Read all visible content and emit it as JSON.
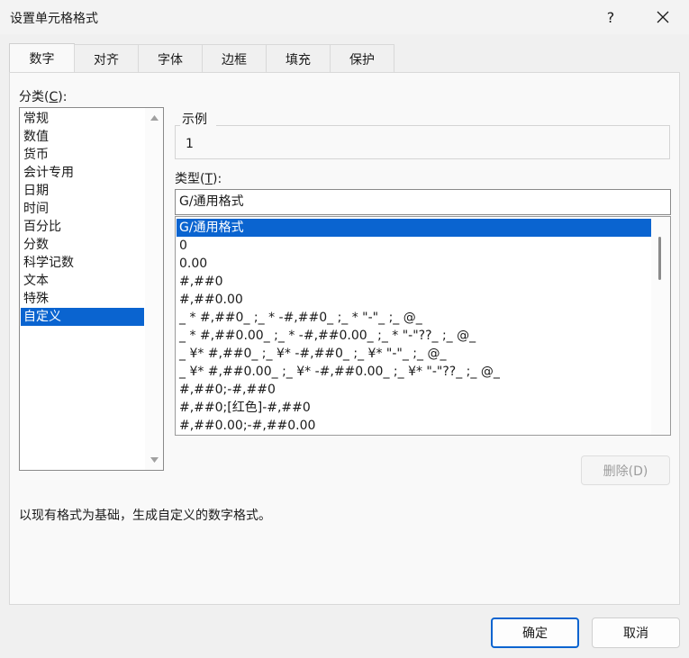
{
  "window": {
    "title": "设置单元格格式",
    "help_label": "?",
    "close_label": "✕"
  },
  "tabs": [
    {
      "label": "数字",
      "active": true
    },
    {
      "label": "对齐"
    },
    {
      "label": "字体"
    },
    {
      "label": "边框"
    },
    {
      "label": "填充"
    },
    {
      "label": "保护"
    }
  ],
  "category": {
    "label_prefix": "分类(",
    "label_key": "C",
    "label_suffix": "):",
    "items": [
      "常规",
      "数值",
      "货币",
      "会计专用",
      "日期",
      "时间",
      "百分比",
      "分数",
      "科学记数",
      "文本",
      "特殊",
      "自定义"
    ],
    "selected": "自定义"
  },
  "sample": {
    "legend": "示例",
    "value": "1"
  },
  "type": {
    "label_prefix": "类型(",
    "label_key": "T",
    "label_suffix": "):",
    "input_value": "G/通用格式",
    "items": [
      "G/通用格式",
      "0",
      "0.00",
      "#,##0",
      "#,##0.00",
      "_ * #,##0_ ;_ * -#,##0_ ;_ * \"-\"_ ;_ @_",
      "_ * #,##0.00_ ;_ * -#,##0.00_ ;_ * \"-\"??_ ;_ @_",
      "_ ¥* #,##0_ ;_ ¥* -#,##0_ ;_ ¥* \"-\"_ ;_ @_",
      "_ ¥* #,##0.00_ ;_ ¥* -#,##0.00_ ;_ ¥* \"-\"??_ ;_ @_",
      "#,##0;-#,##0",
      "#,##0;[红色]-#,##0",
      "#,##0.00;-#,##0.00"
    ],
    "selected": "G/通用格式"
  },
  "delete_button": "删除(D)",
  "description": "以现有格式为基础，生成自定义的数字格式。",
  "ok_button": "确定",
  "cancel_button": "取消",
  "colors": {
    "selection": "#0a64d0",
    "primary_border": "#0a64d0"
  }
}
